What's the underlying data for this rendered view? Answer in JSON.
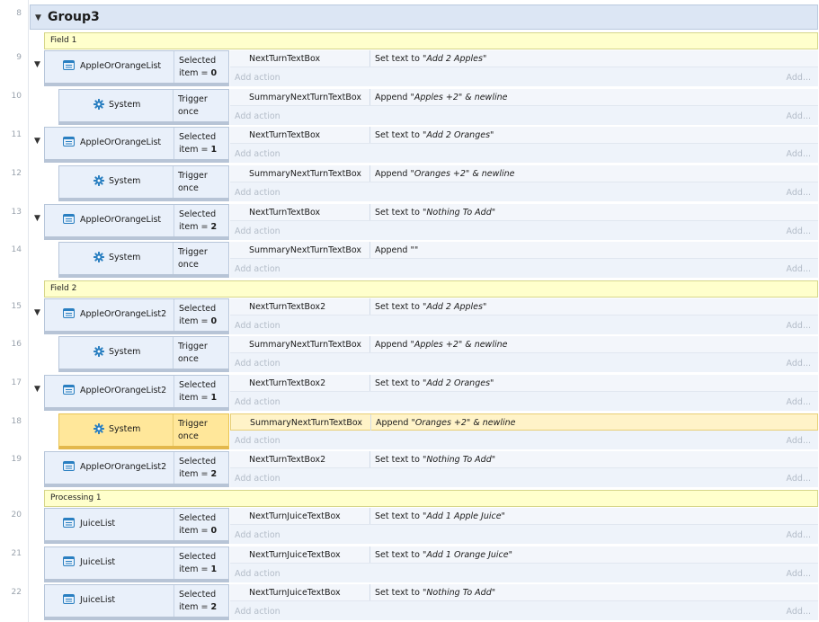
{
  "group": {
    "line": "8",
    "title": "Group3"
  },
  "comments": [
    {
      "text": "Field 1"
    },
    {
      "text": "Field 2"
    },
    {
      "text": "Processing 1"
    }
  ],
  "labels": {
    "add_action": "Add action",
    "add_right": "Add..."
  },
  "icons": {
    "list": "list-object-icon",
    "system": "gear-icon",
    "expand": "triangle-down-icon"
  },
  "events": [
    {
      "line": "9",
      "object": "AppleOrOrangeList",
      "kind": "list",
      "expandable": true,
      "cond1": "Selected",
      "cond2_prefix": "item = ",
      "cond2_value": "0",
      "action_object": "NextTurnTextBox",
      "action_verb": "Set text to ",
      "action_arg": "\"Add 2 Apples\"",
      "action_suffix": ""
    },
    {
      "line": "10",
      "object": "System",
      "kind": "system",
      "cond1": "Trigger",
      "cond2_prefix": "once",
      "cond2_value": "",
      "action_object": "SummaryNextTurnTextBox",
      "action_verb": "Append ",
      "action_arg": "\"Apples +2\" & newline",
      "action_suffix": ""
    },
    {
      "line": "11",
      "object": "AppleOrOrangeList",
      "kind": "list",
      "expandable": true,
      "cond1": "Selected",
      "cond2_prefix": "item = ",
      "cond2_value": "1",
      "action_object": "NextTurnTextBox",
      "action_verb": "Set text to ",
      "action_arg": "\"Add 2 Oranges\"",
      "action_suffix": ""
    },
    {
      "line": "12",
      "object": "System",
      "kind": "system",
      "cond1": "Trigger",
      "cond2_prefix": "once",
      "cond2_value": "",
      "action_object": "SummaryNextTurnTextBox",
      "action_verb": "Append ",
      "action_arg": "\"Oranges +2\" & newline",
      "action_suffix": ""
    },
    {
      "line": "13",
      "object": "AppleOrOrangeList",
      "kind": "list",
      "expandable": true,
      "cond1": "Selected",
      "cond2_prefix": "item = ",
      "cond2_value": "2",
      "action_object": "NextTurnTextBox",
      "action_verb": "Set text to ",
      "action_arg": "\"Nothing To Add\"",
      "action_suffix": ""
    },
    {
      "line": "14",
      "object": "System",
      "kind": "system",
      "cond1": "Trigger",
      "cond2_prefix": "once",
      "cond2_value": "",
      "action_object": "SummaryNextTurnTextBox",
      "action_verb": "Append ",
      "action_arg": "",
      "action_suffix": "\"\""
    },
    {
      "line": "15",
      "object": "AppleOrOrangeList2",
      "kind": "list",
      "expandable": true,
      "cond1": "Selected",
      "cond2_prefix": "item = ",
      "cond2_value": "0",
      "action_object": "NextTurnTextBox2",
      "action_verb": "Set text to ",
      "action_arg": "\"Add 2 Apples\"",
      "action_suffix": ""
    },
    {
      "line": "16",
      "object": "System",
      "kind": "system",
      "cond1": "Trigger",
      "cond2_prefix": "once",
      "cond2_value": "",
      "action_object": "SummaryNextTurnTextBox",
      "action_verb": "Append ",
      "action_arg": "\"Apples +2\" & newline",
      "action_suffix": ""
    },
    {
      "line": "17",
      "object": "AppleOrOrangeList2",
      "kind": "list",
      "expandable": true,
      "cond1": "Selected",
      "cond2_prefix": "item = ",
      "cond2_value": "1",
      "action_object": "NextTurnTextBox2",
      "action_verb": "Set text to ",
      "action_arg": "\"Add 2 Oranges\"",
      "action_suffix": ""
    },
    {
      "line": "18",
      "object": "System",
      "kind": "system",
      "selected": true,
      "cond1": "Trigger",
      "cond2_prefix": "once",
      "cond2_value": "",
      "action_object": "SummaryNextTurnTextBox",
      "action_verb": "Append ",
      "action_arg": "\"Oranges +2\" & newline",
      "action_suffix": ""
    },
    {
      "line": "19",
      "object": "AppleOrOrangeList2",
      "kind": "list",
      "cond1": "Selected",
      "cond2_prefix": "item = ",
      "cond2_value": "2",
      "action_object": "NextTurnTextBox2",
      "action_verb": "Set text to ",
      "action_arg": "\"Nothing To Add\"",
      "action_suffix": ""
    },
    {
      "line": "20",
      "object": "JuiceList",
      "kind": "list",
      "cond1": "Selected",
      "cond2_prefix": "item = ",
      "cond2_value": "0",
      "action_object": "NextTurnJuiceTextBox",
      "action_verb": "Set text to ",
      "action_arg": "\"Add 1 Apple Juice\"",
      "action_suffix": ""
    },
    {
      "line": "21",
      "object": "JuiceList",
      "kind": "list",
      "cond1": "Selected",
      "cond2_prefix": "item = ",
      "cond2_value": "1",
      "action_object": "NextTurnJuiceTextBox",
      "action_verb": "Set text to ",
      "action_arg": "\"Add 1 Orange Juice\"",
      "action_suffix": ""
    },
    {
      "line": "22",
      "object": "JuiceList",
      "kind": "list",
      "cond1": "Selected",
      "cond2_prefix": "item = ",
      "cond2_value": "2",
      "action_object": "NextTurnJuiceTextBox",
      "action_verb": "Set text to ",
      "action_arg": "\"Nothing To Add\"",
      "action_suffix": ""
    }
  ]
}
